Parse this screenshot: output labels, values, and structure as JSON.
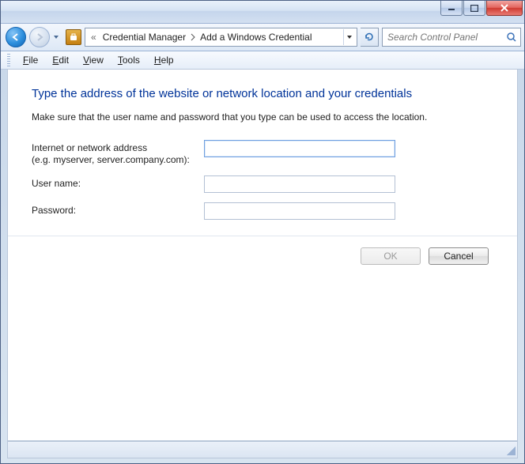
{
  "breadcrumb": {
    "prefix": "«",
    "seg1": "Credential Manager",
    "seg2": "Add a Windows Credential"
  },
  "search": {
    "placeholder": "Search Control Panel"
  },
  "menu": {
    "file": "File",
    "edit": "Edit",
    "view": "View",
    "tools": "Tools",
    "help": "Help"
  },
  "page": {
    "title": "Type the address of the website or network location and your credentials",
    "intro": "Make sure that the user name and password that you type can be used to access the location."
  },
  "form": {
    "address_label_line1": "Internet or network address",
    "address_label_line2": "(e.g. myserver, server.company.com):",
    "address_value": "",
    "username_label": "User name:",
    "username_value": "",
    "password_label": "Password:",
    "password_value": ""
  },
  "buttons": {
    "ok": "OK",
    "cancel": "Cancel"
  }
}
